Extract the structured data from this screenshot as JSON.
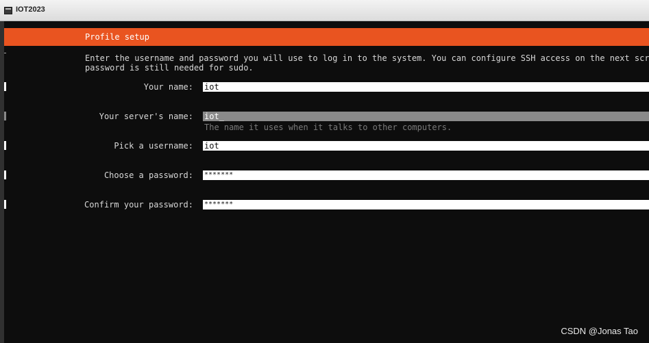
{
  "window": {
    "title": "IOT2023"
  },
  "installer": {
    "header": "Profile setup",
    "intro_line1": "Enter the username and password you will use to log in to the system. You can configure SSH access on the next scr",
    "intro_line2": "password is still needed for sudo.",
    "fields": [
      {
        "label": "Your name:",
        "value": "iot"
      },
      {
        "label": "Your server's name:",
        "value": "iot_",
        "hint": "The name it uses when it talks to other computers."
      },
      {
        "label": "Pick a username:",
        "value": "iot"
      },
      {
        "label": "Choose a password:",
        "value": "*******"
      },
      {
        "label": "Confirm your password:",
        "value": "*******"
      }
    ]
  },
  "watermark": "CSDN @Jonas Tao",
  "colors": {
    "accent": "#e95420",
    "terminal_bg": "#0d0d0d",
    "focused_field": "#8a8a8a"
  },
  "icons": {
    "app": "terminal-window-icon"
  }
}
